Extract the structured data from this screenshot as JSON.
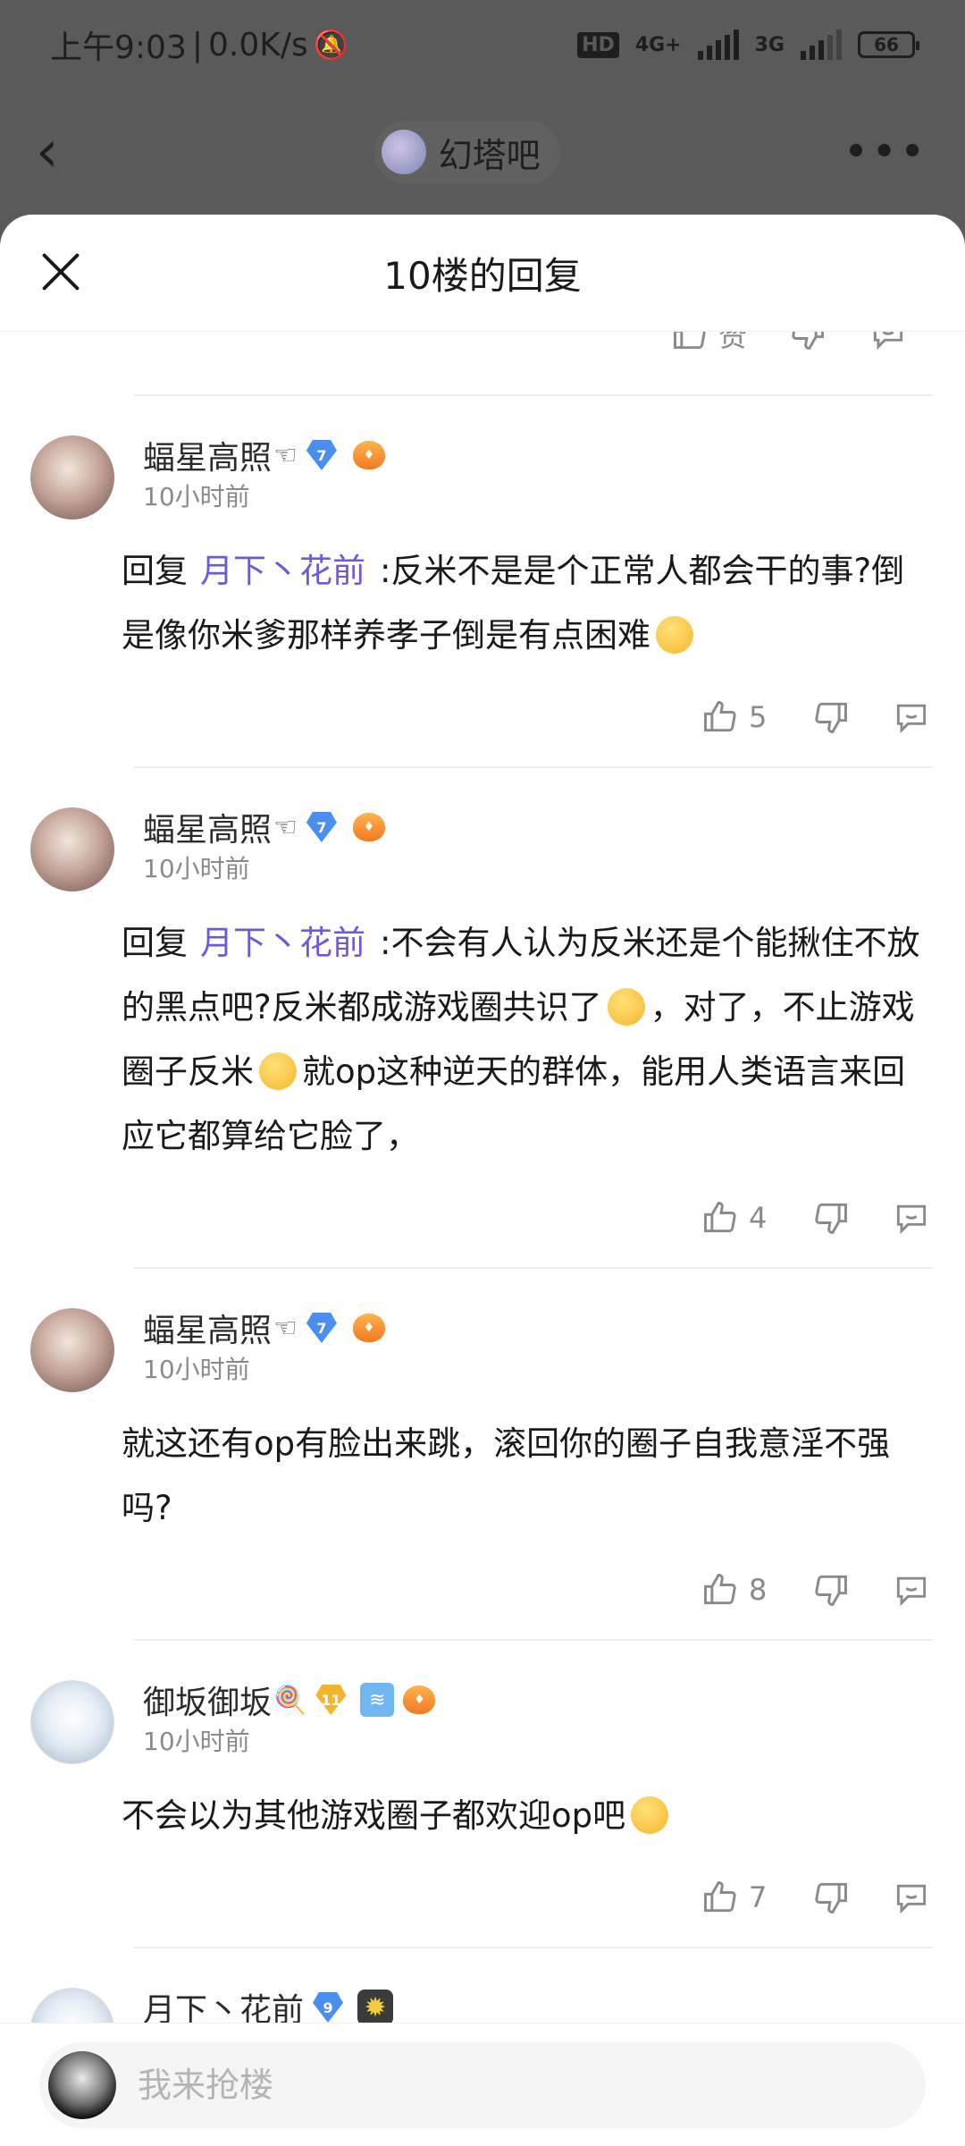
{
  "status_bar": {
    "time": "上午9:03",
    "speed": "0.0K/s",
    "network_hd": "HD",
    "network_4g": "4G+",
    "network_3g": "3G",
    "battery": "66"
  },
  "top_nav": {
    "forum_name": "幻塔吧"
  },
  "sheet": {
    "title": "10楼的回复"
  },
  "prev_actions": {
    "like_label": "赞"
  },
  "comments": [
    {
      "username": "蝠星高照",
      "user_deco": "☜",
      "level": "7",
      "time": "10小时前",
      "reply_prefix": "回复",
      "mention": "月下丶花前",
      "text": ":反米不是是个正常人都会干的事?倒是像你米爹那样养孝子倒是有点困难",
      "likes": "5"
    },
    {
      "username": "蝠星高照",
      "user_deco": "☜",
      "level": "7",
      "time": "10小时前",
      "reply_prefix": "回复",
      "mention": "月下丶花前",
      "text_1": ":不会有人认为反米还是个能揪住不放的黑点吧?反米都成游戏圈共识了",
      "text_2": "，对了，不止游戏圈子反米",
      "text_3": "就op这种逆天的群体，能用人类语言来回应它都算给它脸了，",
      "likes": "4"
    },
    {
      "username": "蝠星高照",
      "user_deco": "☜",
      "level": "7",
      "time": "10小时前",
      "text": "就这还有op有脸出来跳，滚回你的圈子自我意淫不强吗?",
      "likes": "8"
    },
    {
      "username": "御坂御坂",
      "user_deco": "🍭",
      "level": "11",
      "time": "10小时前",
      "text": "不会以为其他游戏圈子都欢迎op吧",
      "likes": "7"
    },
    {
      "username": "月下丶花前",
      "level": "9"
    }
  ],
  "bottom_bar": {
    "input_placeholder": "我来抢楼"
  }
}
